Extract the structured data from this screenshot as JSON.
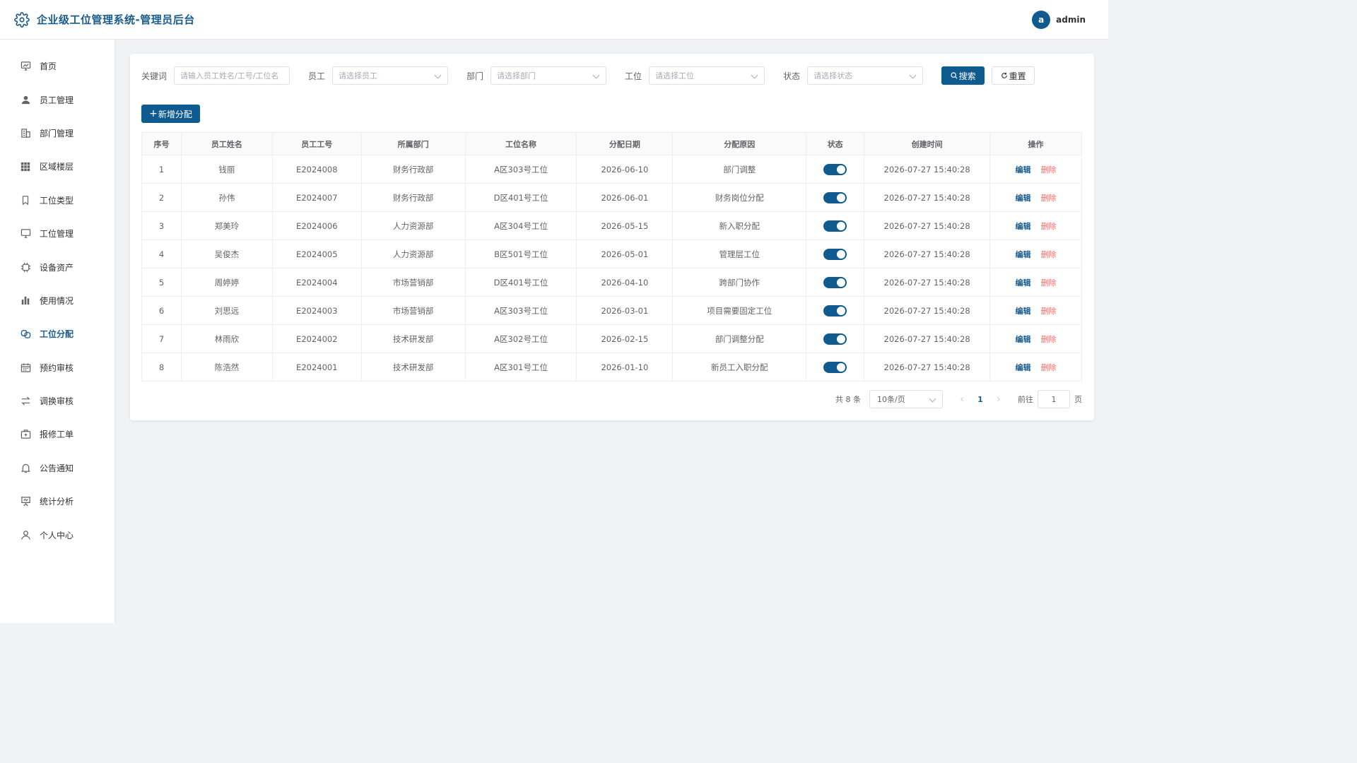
{
  "header": {
    "title": "企业级工位管理系统-管理员后台",
    "avatar_letter": "a",
    "username": "admin"
  },
  "sidebar": {
    "items": [
      {
        "label": "首页",
        "icon": "monitor-chart-icon"
      },
      {
        "label": "员工管理",
        "icon": "user-icon"
      },
      {
        "label": "部门管理",
        "icon": "building-icon"
      },
      {
        "label": "区域楼层",
        "icon": "grid-icon"
      },
      {
        "label": "工位类型",
        "icon": "bookmark-icon"
      },
      {
        "label": "工位管理",
        "icon": "monitor-icon"
      },
      {
        "label": "设备资产",
        "icon": "cpu-icon"
      },
      {
        "label": "使用情况",
        "icon": "bar-chart-icon"
      },
      {
        "label": "工位分配",
        "icon": "link-icon",
        "active": true
      },
      {
        "label": "预约审核",
        "icon": "calendar-icon"
      },
      {
        "label": "调换审核",
        "icon": "swap-icon"
      },
      {
        "label": "报修工单",
        "icon": "toolbox-icon"
      },
      {
        "label": "公告通知",
        "icon": "bell-icon"
      },
      {
        "label": "统计分析",
        "icon": "presentation-icon"
      },
      {
        "label": "个人中心",
        "icon": "user-outline-icon"
      }
    ]
  },
  "filters": {
    "keyword_label": "关键词",
    "keyword_placeholder": "请输入员工姓名/工号/工位名",
    "employee_label": "员工",
    "employee_placeholder": "请选择员工",
    "dept_label": "部门",
    "dept_placeholder": "请选择部门",
    "seat_label": "工位",
    "seat_placeholder": "请选择工位",
    "status_label": "状态",
    "status_placeholder": "请选择状态",
    "search_label": "搜索",
    "reset_label": "重置"
  },
  "toolbar": {
    "add_label": "新增分配"
  },
  "table": {
    "columns": [
      "序号",
      "员工姓名",
      "员工工号",
      "所属部门",
      "工位名称",
      "分配日期",
      "分配原因",
      "状态",
      "创建时间",
      "操作"
    ],
    "edit_label": "编辑",
    "delete_label": "删除",
    "rows": [
      {
        "no": "1",
        "name": "钱丽",
        "id": "E2024008",
        "dept": "财务行政部",
        "seat": "A区303号工位",
        "date": "2026-06-10",
        "reason": "部门调整",
        "status": true,
        "created": "2026-07-27 15:40:28"
      },
      {
        "no": "2",
        "name": "孙伟",
        "id": "E2024007",
        "dept": "财务行政部",
        "seat": "D区401号工位",
        "date": "2026-06-01",
        "reason": "财务岗位分配",
        "status": true,
        "created": "2026-07-27 15:40:28"
      },
      {
        "no": "3",
        "name": "郑美玲",
        "id": "E2024006",
        "dept": "人力资源部",
        "seat": "A区304号工位",
        "date": "2026-05-15",
        "reason": "新入职分配",
        "status": true,
        "created": "2026-07-27 15:40:28"
      },
      {
        "no": "4",
        "name": "吴俊杰",
        "id": "E2024005",
        "dept": "人力资源部",
        "seat": "B区501号工位",
        "date": "2026-05-01",
        "reason": "管理层工位",
        "status": true,
        "created": "2026-07-27 15:40:28"
      },
      {
        "no": "5",
        "name": "周婷婷",
        "id": "E2024004",
        "dept": "市场营销部",
        "seat": "D区401号工位",
        "date": "2026-04-10",
        "reason": "跨部门协作",
        "status": true,
        "created": "2026-07-27 15:40:28"
      },
      {
        "no": "6",
        "name": "刘思远",
        "id": "E2024003",
        "dept": "市场营销部",
        "seat": "A区303号工位",
        "date": "2026-03-01",
        "reason": "项目需要固定工位",
        "status": true,
        "created": "2026-07-27 15:40:28"
      },
      {
        "no": "7",
        "name": "林雨欣",
        "id": "E2024002",
        "dept": "技术研发部",
        "seat": "A区302号工位",
        "date": "2026-02-15",
        "reason": "部门调整分配",
        "status": true,
        "created": "2026-07-27 15:40:28"
      },
      {
        "no": "8",
        "name": "陈浩然",
        "id": "E2024001",
        "dept": "技术研发部",
        "seat": "A区301号工位",
        "date": "2026-01-10",
        "reason": "新员工入职分配",
        "status": true,
        "created": "2026-07-27 15:40:28"
      }
    ]
  },
  "pager": {
    "total_text": "共 8 条",
    "page_size": "10条/页",
    "current_page": "1",
    "goto_label": "前往",
    "goto_value": "1",
    "page_unit": "页"
  },
  "colors": {
    "primary": "#0f5a8e",
    "danger": "#f56c6c",
    "title": "#1a5c8c"
  }
}
